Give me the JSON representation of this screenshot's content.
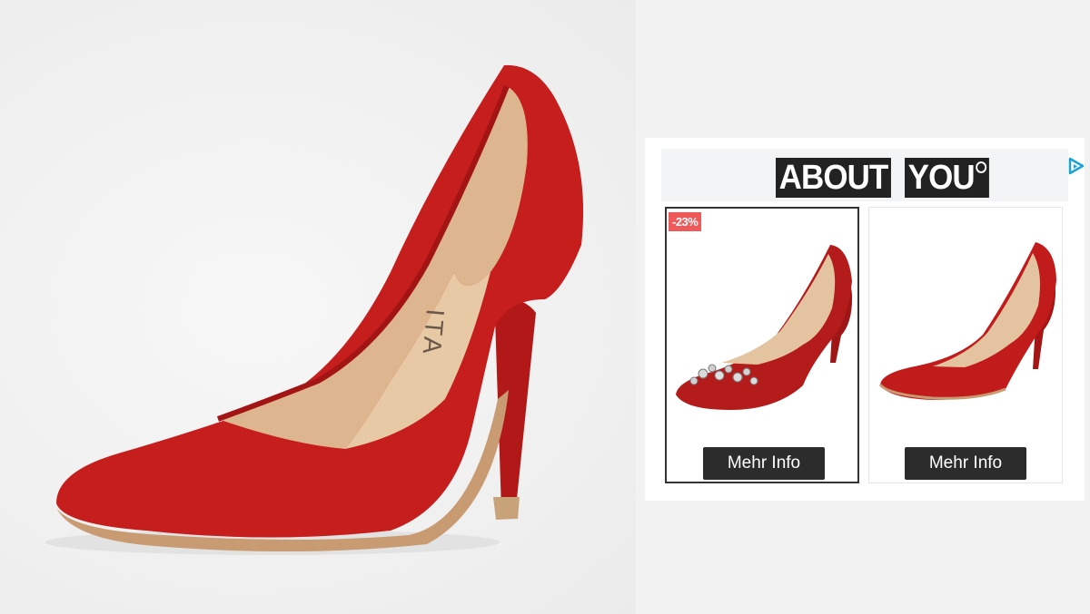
{
  "hero": {
    "image": "red-suede-stiletto-pump",
    "brand_imprint": "ITA",
    "colors": {
      "suede": "#c61d1d",
      "lining": "#ddb58f",
      "background": "#f2f2f2"
    }
  },
  "ad": {
    "logo": {
      "left": "ABOUT",
      "right": "YOU"
    },
    "adchoices_icon": "adchoices-icon",
    "products": [
      {
        "image": "red-velvet-pump-with-crystal-brooch",
        "badge": "-23%",
        "button": "Mehr Info",
        "selected": true
      },
      {
        "image": "red-suede-pump",
        "badge": "",
        "button": "Mehr Info",
        "selected": false
      }
    ],
    "colors": {
      "badge": "#ee5a5a",
      "button": "#2c2c2c",
      "logo": "#222222",
      "adchoices": "#1aa3d9"
    }
  }
}
